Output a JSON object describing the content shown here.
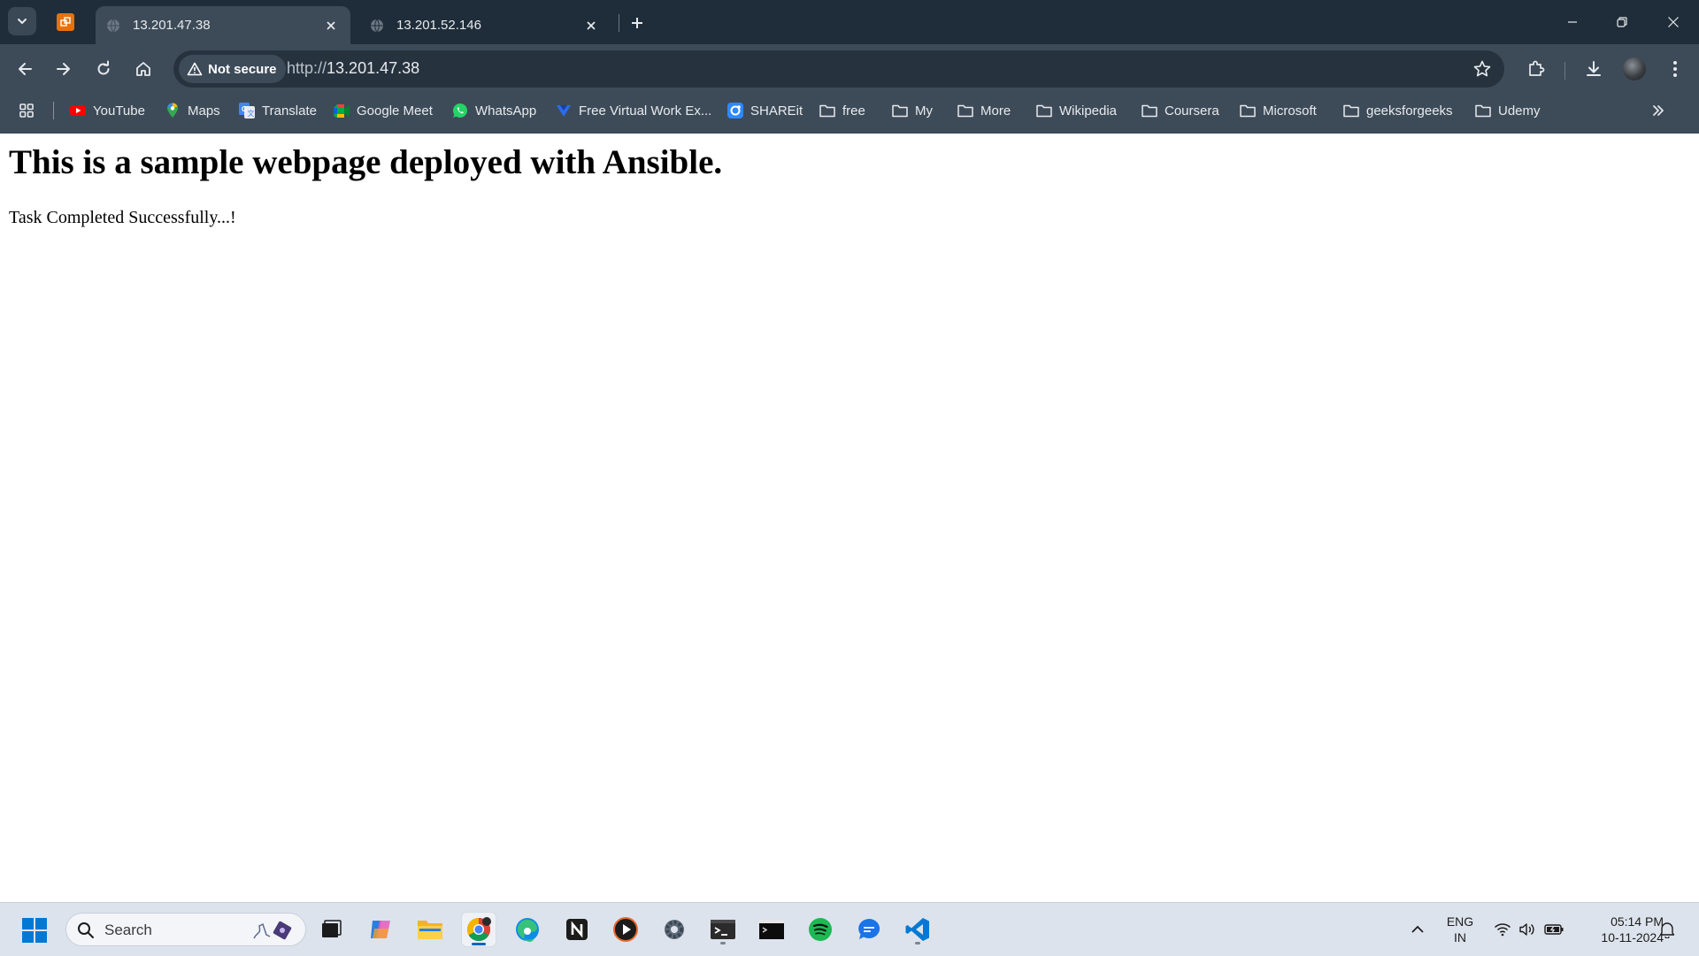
{
  "tabs": [
    {
      "title": "13.201.47.38",
      "active": true
    },
    {
      "title": "13.201.52.146",
      "active": false
    }
  ],
  "omnibox": {
    "security_label": "Not secure",
    "url_scheme": "http://",
    "url_host": "13.201.47.38"
  },
  "bookmarks": [
    {
      "label": "YouTube",
      "icon": "youtube-icon"
    },
    {
      "label": "Maps",
      "icon": "maps-icon"
    },
    {
      "label": "Translate",
      "icon": "translate-icon"
    },
    {
      "label": "Google Meet",
      "icon": "google-meet-icon"
    },
    {
      "label": "WhatsApp",
      "icon": "whatsapp-icon"
    },
    {
      "label": "Free Virtual Work Ex...",
      "icon": "forage-icon"
    },
    {
      "label": "SHAREit",
      "icon": "shareit-icon"
    },
    {
      "label": "free",
      "icon": "folder-icon"
    },
    {
      "label": "My",
      "icon": "folder-icon"
    },
    {
      "label": "More",
      "icon": "folder-icon"
    },
    {
      "label": "Wikipedia",
      "icon": "folder-icon"
    },
    {
      "label": "Coursera",
      "icon": "folder-icon"
    },
    {
      "label": "Microsoft",
      "icon": "folder-icon"
    },
    {
      "label": "geeksforgeeks",
      "icon": "folder-icon"
    },
    {
      "label": "Udemy",
      "icon": "folder-icon"
    }
  ],
  "page": {
    "heading": "This is a sample webpage deployed with Ansible.",
    "message": "Task Completed Successfully...!"
  },
  "taskbar": {
    "search_placeholder": "Search",
    "apps": [
      "file-explorer-icon",
      "copilot-icon",
      "folder-icon",
      "chrome-icon",
      "edge-icon",
      "notion-icon",
      "media-player-icon",
      "settings-icon",
      "terminal-icon",
      "command-prompt-icon",
      "spotify-icon",
      "messenger-icon",
      "vscode-icon"
    ],
    "language_line1": "ENG",
    "language_line2": "IN",
    "time": "05:14 PM",
    "date": "10-11-2024"
  },
  "colors": {
    "tabstrip_bg": "#1f2d3a",
    "toolbar_bg": "#3d4b59",
    "omnibox_bg": "#26333f",
    "taskbar_bg": "#dde3ec"
  }
}
